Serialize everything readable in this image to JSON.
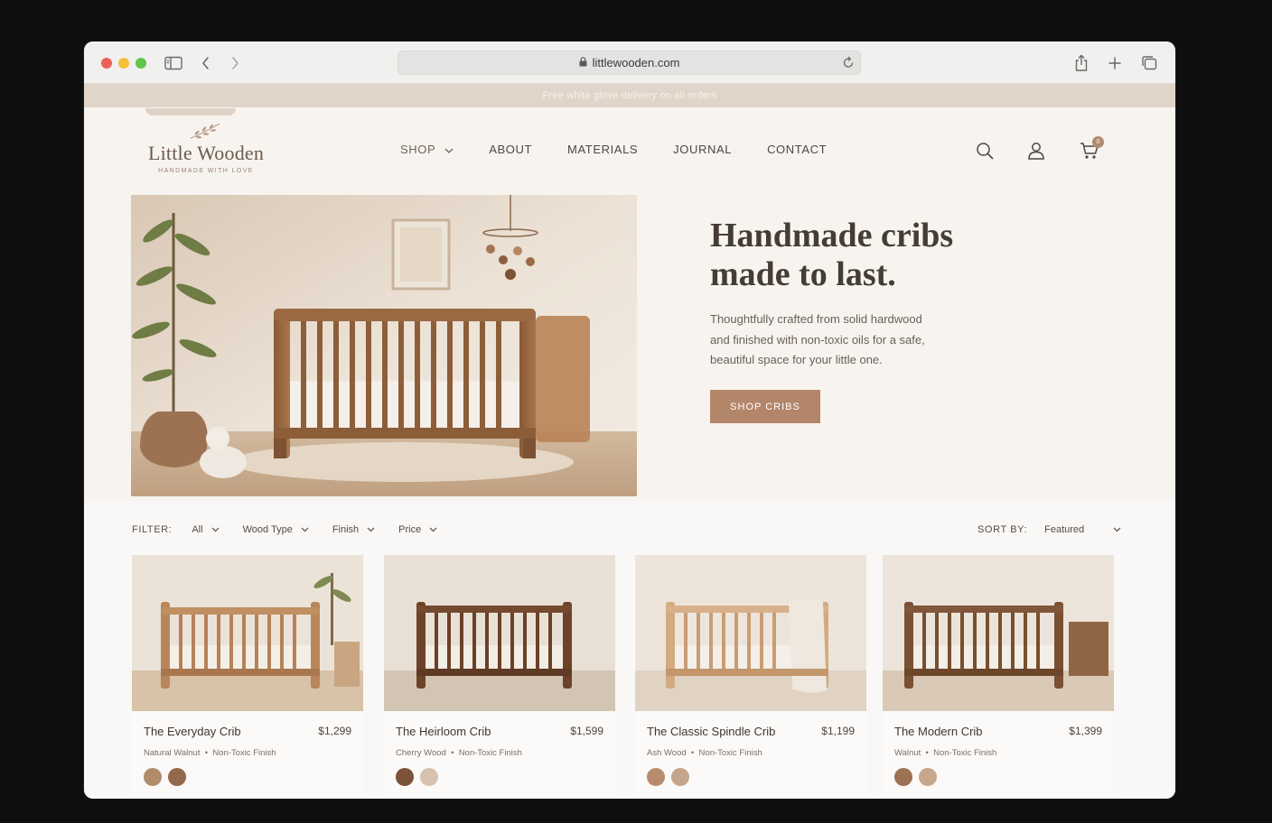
{
  "browser": {
    "url": "littlewooden.com"
  },
  "announcement": "Free white glove delivery on all orders",
  "logo": {
    "title": "Little Wooden",
    "subtitle": "HANDMADE WITH LOVE"
  },
  "nav": {
    "items": [
      "SHOP",
      "ABOUT",
      "MATERIALS",
      "JOURNAL",
      "CONTACT"
    ]
  },
  "cart": {
    "count": "0"
  },
  "hero": {
    "title_line1": "Handmade cribs",
    "title_line2": "made to last.",
    "text": "Thoughtfully crafted from solid hardwood and finished with non-toxic oils for a safe, beautiful space for your little one.",
    "button": "SHOP CRIBS"
  },
  "filters": {
    "label": "FILTER:",
    "options": [
      "All",
      "Wood Type",
      "Finish",
      "Price"
    ],
    "sort_label": "SORT BY:",
    "sort_value": "Featured"
  },
  "products": [
    {
      "name": "The Everyday Crib",
      "price": "$1,299",
      "wood": "Natural Walnut",
      "finish": "Non-Toxic Finish",
      "swatches": [
        "#b18c6c",
        "#94684a"
      ]
    },
    {
      "name": "The Heirloom Crib",
      "price": "$1,599",
      "wood": "Cherry Wood",
      "finish": "Non-Toxic Finish",
      "swatches": [
        "#7d5238",
        "#d6c2ae"
      ]
    },
    {
      "name": "The Classic Spindle Crib",
      "price": "$1,199",
      "wood": "Ash Wood",
      "finish": "Non-Toxic Finish",
      "swatches": [
        "#b78c6c",
        "#c4a58c"
      ]
    },
    {
      "name": "The Modern Crib",
      "price": "$1,399",
      "wood": "Walnut",
      "finish": "Non-Toxic Finish",
      "swatches": [
        "#9c7154",
        "#c7a68b"
      ]
    }
  ],
  "colors": {
    "accent": "#b3866a",
    "announcement_bg": "#e1d4c9",
    "page_bg": "#f7f4f0"
  }
}
